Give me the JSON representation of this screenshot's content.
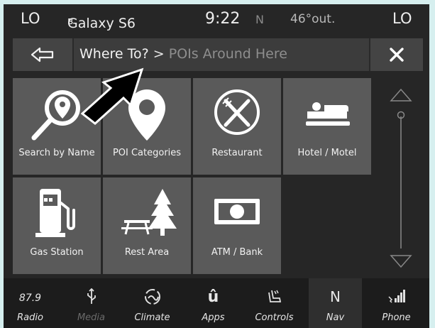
{
  "status": {
    "left_zone": "LO",
    "phone_name": "Galaxy S6",
    "bluetooth_glyph": "ʙ",
    "time": "9:22",
    "heading": "N",
    "temp": "46°out.",
    "right_zone": "LO"
  },
  "nav": {
    "crumb_parent": "Where To?",
    "crumb_sep": " > ",
    "crumb_current": "POIs Around Here"
  },
  "tiles": [
    {
      "label": "Search by Name",
      "icon": "search-pin-icon"
    },
    {
      "label": "POI Categories",
      "icon": "poi-pin-icon"
    },
    {
      "label": "Restaurant",
      "icon": "restaurant-icon"
    },
    {
      "label": "Hotel / Motel",
      "icon": "bed-icon"
    },
    {
      "label": "Gas Station",
      "icon": "gas-pump-icon"
    },
    {
      "label": "Rest Area",
      "icon": "picnic-tree-icon"
    },
    {
      "label": "ATM / Bank",
      "icon": "cash-icon"
    }
  ],
  "bottom": {
    "radio_freq": "87.9",
    "items": [
      {
        "label": "Radio",
        "icon": "radio-icon"
      },
      {
        "label": "Media",
        "icon": "usb-icon"
      },
      {
        "label": "Climate",
        "icon": "climate-icon"
      },
      {
        "label": "Apps",
        "icon": "apps-icon"
      },
      {
        "label": "Controls",
        "icon": "seat-icon"
      },
      {
        "label": "Nav",
        "icon": "compass-icon"
      },
      {
        "label": "Phone",
        "icon": "phone-signal-icon"
      }
    ],
    "nav_compass_letter": "N"
  },
  "colors": {
    "tile_bg": "#5a5a5a",
    "screen_bg": "#262626",
    "page_bg": "#d6efef"
  }
}
